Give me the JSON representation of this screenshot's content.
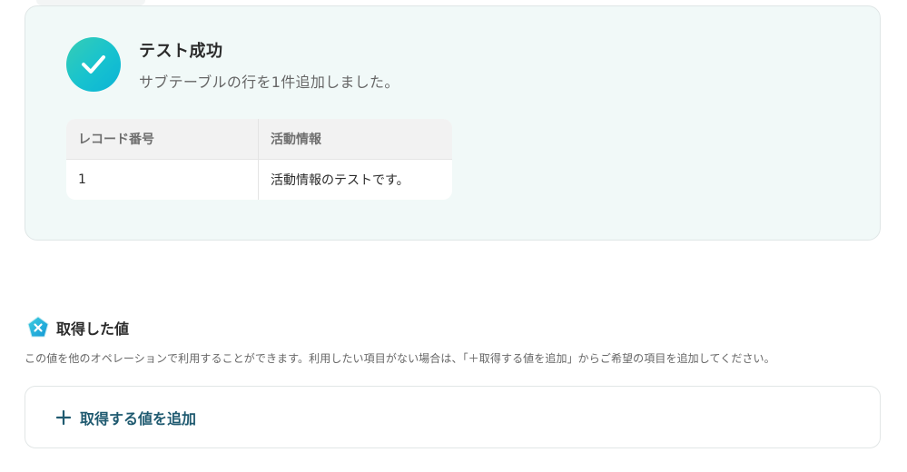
{
  "success": {
    "title": "テスト成功",
    "subtitle": "サブテーブルの行を1件追加しました。",
    "icon": "check-circle-icon",
    "accent_color": "#1cc3c9"
  },
  "result_table": {
    "columns": [
      "レコード番号",
      "活動情報"
    ],
    "rows": [
      [
        "1",
        "活動情報のテストです。"
      ]
    ]
  },
  "obtained": {
    "title": "取得した値",
    "icon": "yoom-badge-icon",
    "description": "この値を他のオペレーションで利用することができます。利用したい項目がない場合は、「＋取得する値を追加」からご希望の項目を追加してください。",
    "add_button_label": "取得する値を追加",
    "add_icon": "plus-icon",
    "button_color": "#1f5a70"
  }
}
